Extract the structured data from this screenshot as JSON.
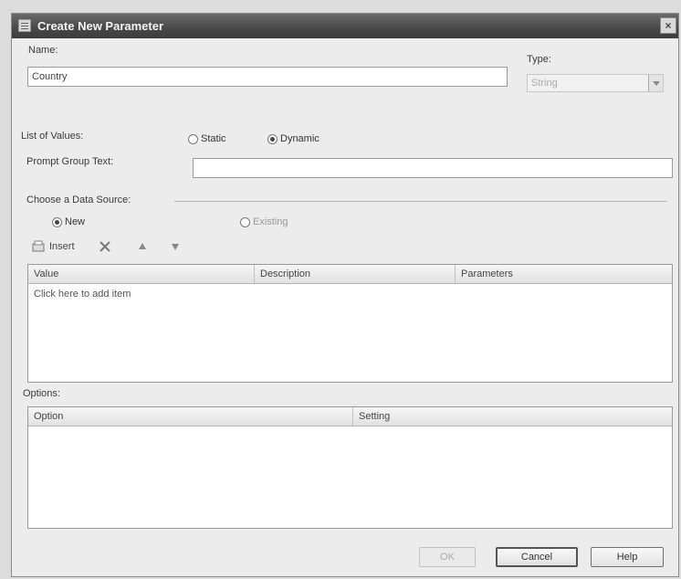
{
  "dialog": {
    "title": "Create New Parameter",
    "close_symbol": "×"
  },
  "name_field": {
    "label": "Name:",
    "value": "Country"
  },
  "type_field": {
    "label": "Type:",
    "value": "String"
  },
  "list_of_values": {
    "label": "List of Values:",
    "options": [
      {
        "label": "Static",
        "selected": false
      },
      {
        "label": "Dynamic",
        "selected": true
      }
    ]
  },
  "prompt_group_text": {
    "label": "Prompt Group Text:",
    "value": ""
  },
  "data_source": {
    "label": "Choose a Data Source:",
    "options": [
      {
        "label": "New",
        "selected": true
      },
      {
        "label": "Existing",
        "selected": false
      }
    ]
  },
  "toolbar": {
    "insert_label": "Insert",
    "icons": [
      "delete-icon",
      "move-up-icon",
      "move-down-icon"
    ]
  },
  "values_grid": {
    "columns": [
      "Value",
      "Description",
      "Parameters"
    ],
    "placeholder_row": "Click here to add item"
  },
  "options_section": {
    "label": "Options:",
    "columns": [
      "Option",
      "Setting"
    ]
  },
  "buttons": {
    "ok": "OK",
    "cancel": "Cancel",
    "help": "Help"
  }
}
